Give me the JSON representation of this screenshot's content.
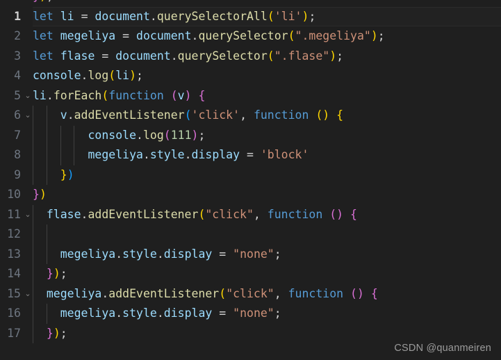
{
  "editor": {
    "theme": "dark-plus",
    "language": "javascript",
    "background_color": "#1f1f1f",
    "active_line": 1,
    "total_lines": 17,
    "colors": {
      "keyword": "#569cd6",
      "variable": "#9cdcfe",
      "function": "#dcdcaa",
      "string": "#ce9178",
      "number": "#b5cea8",
      "operator": "#d4d4d4",
      "bracket_level_1": "#ffd700",
      "bracket_level_2": "#da70d6",
      "bracket_level_3": "#179fff",
      "line_number": "#6e7681",
      "active_line_number": "#cfcfcf",
      "indent_guide": "#404040"
    },
    "clipped_top_line": "});",
    "lines": [
      {
        "number": 1,
        "active": true,
        "fold": false,
        "indent_guides": 0,
        "text": "let li = document.querySelectorAll('li');",
        "tokens": [
          {
            "t": "let",
            "c": "kw"
          },
          {
            "t": " ",
            "c": "pl"
          },
          {
            "t": "li",
            "c": "var"
          },
          {
            "t": " ",
            "c": "pl"
          },
          {
            "t": "=",
            "c": "op"
          },
          {
            "t": " ",
            "c": "pl"
          },
          {
            "t": "document",
            "c": "var"
          },
          {
            "t": ".",
            "c": "op"
          },
          {
            "t": "querySelectorAll",
            "c": "fn"
          },
          {
            "t": "(",
            "c": "b1"
          },
          {
            "t": "'li'",
            "c": "str"
          },
          {
            "t": ")",
            "c": "b1"
          },
          {
            "t": ";",
            "c": "op"
          }
        ]
      },
      {
        "number": 2,
        "active": false,
        "fold": false,
        "indent_guides": 0,
        "text": "let megeliya = document.querySelector(\".megeliya\");",
        "tokens": [
          {
            "t": "let",
            "c": "kw"
          },
          {
            "t": " ",
            "c": "pl"
          },
          {
            "t": "megeliya",
            "c": "var"
          },
          {
            "t": " ",
            "c": "pl"
          },
          {
            "t": "=",
            "c": "op"
          },
          {
            "t": " ",
            "c": "pl"
          },
          {
            "t": "document",
            "c": "var"
          },
          {
            "t": ".",
            "c": "op"
          },
          {
            "t": "querySelector",
            "c": "fn"
          },
          {
            "t": "(",
            "c": "b1"
          },
          {
            "t": "\".megeliya\"",
            "c": "str"
          },
          {
            "t": ")",
            "c": "b1"
          },
          {
            "t": ";",
            "c": "op"
          }
        ]
      },
      {
        "number": 3,
        "active": false,
        "fold": false,
        "indent_guides": 0,
        "text": "let flase = document.querySelector(\".flase\");",
        "tokens": [
          {
            "t": "let",
            "c": "kw"
          },
          {
            "t": " ",
            "c": "pl"
          },
          {
            "t": "flase",
            "c": "var"
          },
          {
            "t": " ",
            "c": "pl"
          },
          {
            "t": "=",
            "c": "op"
          },
          {
            "t": " ",
            "c": "pl"
          },
          {
            "t": "document",
            "c": "var"
          },
          {
            "t": ".",
            "c": "op"
          },
          {
            "t": "querySelector",
            "c": "fn"
          },
          {
            "t": "(",
            "c": "b1"
          },
          {
            "t": "\".flase\"",
            "c": "str"
          },
          {
            "t": ")",
            "c": "b1"
          },
          {
            "t": ";",
            "c": "op"
          }
        ]
      },
      {
        "number": 4,
        "active": false,
        "fold": false,
        "indent_guides": 0,
        "text": "console.log(li);",
        "tokens": [
          {
            "t": "console",
            "c": "var"
          },
          {
            "t": ".",
            "c": "op"
          },
          {
            "t": "log",
            "c": "fn"
          },
          {
            "t": "(",
            "c": "b1"
          },
          {
            "t": "li",
            "c": "var"
          },
          {
            "t": ")",
            "c": "b1"
          },
          {
            "t": ";",
            "c": "op"
          }
        ]
      },
      {
        "number": 5,
        "active": false,
        "fold": true,
        "indent_guides": 0,
        "text": "li.forEach(function (v) {",
        "tokens": [
          {
            "t": "li",
            "c": "var"
          },
          {
            "t": ".",
            "c": "op"
          },
          {
            "t": "forEach",
            "c": "fn"
          },
          {
            "t": "(",
            "c": "b1"
          },
          {
            "t": "function",
            "c": "kw"
          },
          {
            "t": " ",
            "c": "pl"
          },
          {
            "t": "(",
            "c": "b2"
          },
          {
            "t": "v",
            "c": "var"
          },
          {
            "t": ")",
            "c": "b2"
          },
          {
            "t": " ",
            "c": "pl"
          },
          {
            "t": "{",
            "c": "b2"
          }
        ]
      },
      {
        "number": 6,
        "active": false,
        "fold": true,
        "indent_guides": 2,
        "text": "    v.addEventListener('click', function () {",
        "tokens": [
          {
            "t": "    ",
            "c": "pl"
          },
          {
            "t": "v",
            "c": "var"
          },
          {
            "t": ".",
            "c": "op"
          },
          {
            "t": "addEventListener",
            "c": "fn"
          },
          {
            "t": "(",
            "c": "b3"
          },
          {
            "t": "'click'",
            "c": "str"
          },
          {
            "t": ",",
            "c": "op"
          },
          {
            "t": " ",
            "c": "pl"
          },
          {
            "t": "function",
            "c": "kw"
          },
          {
            "t": " ",
            "c": "pl"
          },
          {
            "t": "(",
            "c": "b1"
          },
          {
            "t": ")",
            "c": "b1"
          },
          {
            "t": " ",
            "c": "pl"
          },
          {
            "t": "{",
            "c": "b1"
          }
        ]
      },
      {
        "number": 7,
        "active": false,
        "fold": false,
        "indent_guides": 4,
        "text": "        console.log(111);",
        "tokens": [
          {
            "t": "        ",
            "c": "pl"
          },
          {
            "t": "console",
            "c": "var"
          },
          {
            "t": ".",
            "c": "op"
          },
          {
            "t": "log",
            "c": "fn"
          },
          {
            "t": "(",
            "c": "b2"
          },
          {
            "t": "111",
            "c": "num"
          },
          {
            "t": ")",
            "c": "b2"
          },
          {
            "t": ";",
            "c": "op"
          }
        ]
      },
      {
        "number": 8,
        "active": false,
        "fold": false,
        "indent_guides": 4,
        "text": "        megeliya.style.display = 'block'",
        "tokens": [
          {
            "t": "        ",
            "c": "pl"
          },
          {
            "t": "megeliya",
            "c": "var"
          },
          {
            "t": ".",
            "c": "op"
          },
          {
            "t": "style",
            "c": "var"
          },
          {
            "t": ".",
            "c": "op"
          },
          {
            "t": "display",
            "c": "var"
          },
          {
            "t": " ",
            "c": "pl"
          },
          {
            "t": "=",
            "c": "op"
          },
          {
            "t": " ",
            "c": "pl"
          },
          {
            "t": "'block'",
            "c": "str"
          }
        ]
      },
      {
        "number": 9,
        "active": false,
        "fold": false,
        "indent_guides": 2,
        "text": "    })",
        "tokens": [
          {
            "t": "    ",
            "c": "pl"
          },
          {
            "t": "}",
            "c": "b1"
          },
          {
            "t": ")",
            "c": "b3"
          }
        ]
      },
      {
        "number": 10,
        "active": false,
        "fold": false,
        "indent_guides": 0,
        "text": "})",
        "tokens": [
          {
            "t": "}",
            "c": "b2"
          },
          {
            "t": ")",
            "c": "b1"
          }
        ]
      },
      {
        "number": 11,
        "active": false,
        "fold": true,
        "indent_guides": 1,
        "text": "  flase.addEventListener(\"click\", function () {",
        "tokens": [
          {
            "t": "  ",
            "c": "pl"
          },
          {
            "t": "flase",
            "c": "var"
          },
          {
            "t": ".",
            "c": "op"
          },
          {
            "t": "addEventListener",
            "c": "fn"
          },
          {
            "t": "(",
            "c": "b1"
          },
          {
            "t": "\"click\"",
            "c": "str"
          },
          {
            "t": ",",
            "c": "op"
          },
          {
            "t": " ",
            "c": "pl"
          },
          {
            "t": "function",
            "c": "kw"
          },
          {
            "t": " ",
            "c": "pl"
          },
          {
            "t": "(",
            "c": "b2"
          },
          {
            "t": ")",
            "c": "b2"
          },
          {
            "t": " ",
            "c": "pl"
          },
          {
            "t": "{",
            "c": "b2"
          }
        ]
      },
      {
        "number": 12,
        "active": false,
        "fold": false,
        "indent_guides": 2,
        "text": "",
        "tokens": []
      },
      {
        "number": 13,
        "active": false,
        "fold": false,
        "indent_guides": 2,
        "text": "    megeliya.style.display = \"none\";",
        "tokens": [
          {
            "t": "    ",
            "c": "pl"
          },
          {
            "t": "megeliya",
            "c": "var"
          },
          {
            "t": ".",
            "c": "op"
          },
          {
            "t": "style",
            "c": "var"
          },
          {
            "t": ".",
            "c": "op"
          },
          {
            "t": "display",
            "c": "var"
          },
          {
            "t": " ",
            "c": "pl"
          },
          {
            "t": "=",
            "c": "op"
          },
          {
            "t": " ",
            "c": "pl"
          },
          {
            "t": "\"none\"",
            "c": "str"
          },
          {
            "t": ";",
            "c": "op"
          }
        ]
      },
      {
        "number": 14,
        "active": false,
        "fold": false,
        "indent_guides": 1,
        "text": "  });",
        "tokens": [
          {
            "t": "  ",
            "c": "pl"
          },
          {
            "t": "}",
            "c": "b2"
          },
          {
            "t": ")",
            "c": "b1"
          },
          {
            "t": ";",
            "c": "op"
          }
        ]
      },
      {
        "number": 15,
        "active": false,
        "fold": true,
        "indent_guides": 1,
        "text": "  megeliya.addEventListener(\"click\", function () {",
        "tokens": [
          {
            "t": "  ",
            "c": "pl"
          },
          {
            "t": "megeliya",
            "c": "var"
          },
          {
            "t": ".",
            "c": "op"
          },
          {
            "t": "addEventListener",
            "c": "fn"
          },
          {
            "t": "(",
            "c": "b1"
          },
          {
            "t": "\"click\"",
            "c": "str"
          },
          {
            "t": ",",
            "c": "op"
          },
          {
            "t": " ",
            "c": "pl"
          },
          {
            "t": "function",
            "c": "kw"
          },
          {
            "t": " ",
            "c": "pl"
          },
          {
            "t": "(",
            "c": "b2"
          },
          {
            "t": ")",
            "c": "b2"
          },
          {
            "t": " ",
            "c": "pl"
          },
          {
            "t": "{",
            "c": "b2"
          }
        ]
      },
      {
        "number": 16,
        "active": false,
        "fold": false,
        "indent_guides": 2,
        "text": "    megeliya.style.display = \"none\";",
        "tokens": [
          {
            "t": "    ",
            "c": "pl"
          },
          {
            "t": "megeliya",
            "c": "var"
          },
          {
            "t": ".",
            "c": "op"
          },
          {
            "t": "style",
            "c": "var"
          },
          {
            "t": ".",
            "c": "op"
          },
          {
            "t": "display",
            "c": "var"
          },
          {
            "t": " ",
            "c": "pl"
          },
          {
            "t": "=",
            "c": "op"
          },
          {
            "t": " ",
            "c": "pl"
          },
          {
            "t": "\"none\"",
            "c": "str"
          },
          {
            "t": ";",
            "c": "op"
          }
        ]
      },
      {
        "number": 17,
        "active": false,
        "fold": false,
        "indent_guides": 1,
        "text": "  });",
        "tokens": [
          {
            "t": "  ",
            "c": "pl"
          },
          {
            "t": "}",
            "c": "b2"
          },
          {
            "t": ")",
            "c": "b1"
          },
          {
            "t": ";",
            "c": "op"
          }
        ]
      }
    ]
  },
  "watermark": {
    "text": "CSDN @quanmeiren"
  }
}
